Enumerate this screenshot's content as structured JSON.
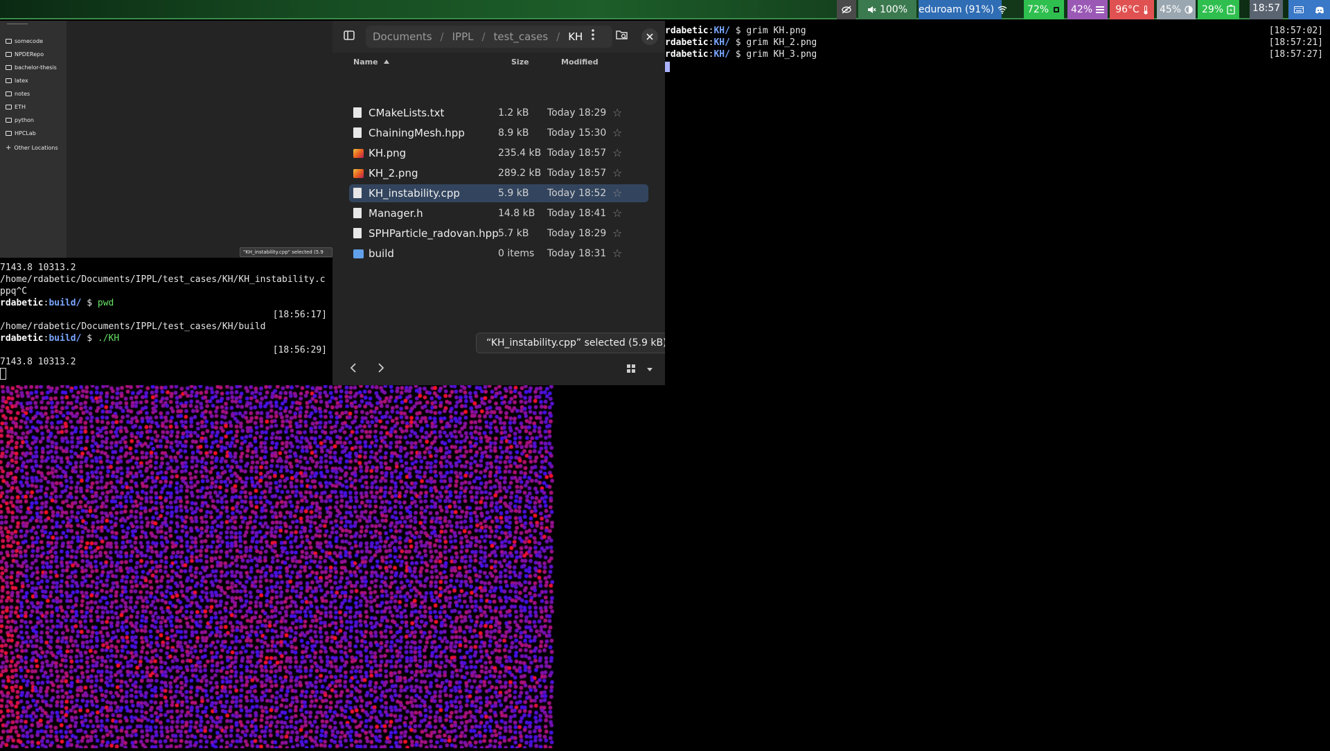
{
  "topbar": {
    "modules": [
      {
        "id": "privacy",
        "text": "",
        "icon": "eye-slash-icon",
        "bg": "#4a4a4a"
      },
      {
        "id": "volume",
        "text": "100%",
        "icon": "speaker-muted-icon",
        "bg": "#3b7a4f"
      },
      {
        "id": "network",
        "text": "eduroam (91%)",
        "icon": "wifi-icon",
        "bg": "#2f6db5"
      },
      {
        "id": "cpu",
        "text": "72%",
        "icon": "cpu-icon",
        "bg": "#2fbf4f"
      },
      {
        "id": "memory",
        "text": "42%",
        "icon": "memory-icon",
        "bg": "#9b59b6"
      },
      {
        "id": "temperature",
        "text": "96°C",
        "icon": "thermometer-icon",
        "bg": "#e05252"
      },
      {
        "id": "backlight",
        "text": "45%",
        "icon": "brightness-icon",
        "bg": "#9aa7b0"
      },
      {
        "id": "battery",
        "text": "29%",
        "icon": "battery-charging-icon",
        "bg": "#2fbf4f"
      },
      {
        "id": "clock",
        "text": "18:57",
        "icon": "",
        "bg": "#5a6470"
      },
      {
        "id": "keyboard",
        "text": "",
        "icon": "keyboard-icon",
        "bg": "#3a78c8"
      },
      {
        "id": "discord",
        "text": "",
        "icon": "discord-icon",
        "bg": "#3a78c8"
      }
    ]
  },
  "sidebar": {
    "items": [
      "somecode",
      "NPDERepo",
      "bachelor-thesis",
      "latex",
      "notes",
      "ETH",
      "python",
      "HPCLab"
    ],
    "other_locations": "Other Locations",
    "toast": "\"KH_instability.cpp\" selected (5.9 kB)"
  },
  "terminal_left": {
    "lines": [
      {
        "text": "7143.8 10313.2"
      },
      {
        "text": "/home/rdabetic/Documents/IPPL/test_cases/KH/KH_instability.c"
      },
      {
        "text": "ppq^C"
      },
      {
        "user": "rdabetic",
        "dir": "build/",
        "prompt": " $ ",
        "cmd": "pwd"
      },
      {
        "time": "[18:56:17]"
      },
      {
        "text": "/home/rdabetic/Documents/IPPL/test_cases/KH/build"
      },
      {
        "user": "rdabetic",
        "dir": "build/",
        "prompt": " $ ",
        "cmd": "./KH"
      },
      {
        "time": "[18:56:29]"
      },
      {
        "text": "7143.8 10313.2"
      }
    ]
  },
  "filemanager": {
    "breadcrumbs": [
      "Documents",
      "IPPL",
      "test_cases",
      "KH"
    ],
    "columns": {
      "name": "Name",
      "size": "Size",
      "modified": "Modified"
    },
    "files": [
      {
        "name": "CMakeLists.txt",
        "size": "1.2 kB",
        "modified": "Today 18:29",
        "type": "doc",
        "selected": false
      },
      {
        "name": "ChainingMesh.hpp",
        "size": "8.9 kB",
        "modified": "Today 15:30",
        "type": "doc",
        "selected": false
      },
      {
        "name": "KH.png",
        "size": "235.4 kB",
        "modified": "Today 18:57",
        "type": "image",
        "selected": false
      },
      {
        "name": "KH_2.png",
        "size": "289.2 kB",
        "modified": "Today 18:57",
        "type": "image",
        "selected": false
      },
      {
        "name": "KH_instability.cpp",
        "size": "5.9 kB",
        "modified": "Today 18:52",
        "type": "doc",
        "selected": true
      },
      {
        "name": "Manager.h",
        "size": "14.8 kB",
        "modified": "Today 18:41",
        "type": "doc",
        "selected": false
      },
      {
        "name": "SPHParticle_radovan.hpp",
        "size": "5.7 kB",
        "modified": "Today 18:29",
        "type": "doc",
        "selected": false
      },
      {
        "name": "build",
        "size": "0 items",
        "modified": "Today 18:31",
        "type": "folder",
        "selected": false
      }
    ],
    "status_toast": "“KH_instability.cpp” selected  (5.9 kB)"
  },
  "terminal_right": {
    "lines": [
      {
        "user": "rdabetic",
        "dir": "KH/",
        "prompt": " $ ",
        "cmd": "grim KH.png",
        "time": "[18:57:02]"
      },
      {
        "user": "rdabetic",
        "dir": "KH/",
        "prompt": " $ ",
        "cmd": "grim KH_2.png",
        "time": "[18:57:21]"
      },
      {
        "user": "rdabetic",
        "dir": "KH/",
        "prompt": " $ ",
        "cmd": "grim KH_3.png",
        "time": "[18:57:27]"
      }
    ]
  },
  "colors": {
    "particle_low": "#2a10ff",
    "particle_high": "#ff1020",
    "selection": "#33455e",
    "prompt_dir": "#79a6ff",
    "prompt_cmd": "#66e266"
  }
}
